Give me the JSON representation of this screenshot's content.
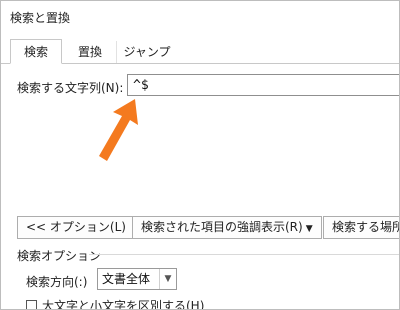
{
  "window": {
    "title": "検索と置換"
  },
  "tabs": [
    {
      "label": "検索",
      "active": true
    },
    {
      "label": "置換",
      "active": false
    },
    {
      "label": "ジャンプ",
      "active": false
    }
  ],
  "find": {
    "label": "検索する文字列(N):",
    "value": "^$"
  },
  "buttons": {
    "options": "<< オプション(L)",
    "highlight": "検索された項目の強調表示(R)",
    "find_in": "検索する場所(I)"
  },
  "search_options": {
    "group_label": "検索オプション",
    "direction_label": "検索方向(:)",
    "direction_value": "文書全体",
    "match_case_label": "大文字と小文字を区別する(H)"
  },
  "annotation": {
    "arrow_color": "#f47a1f",
    "icon": "arrow-up-right-icon"
  }
}
